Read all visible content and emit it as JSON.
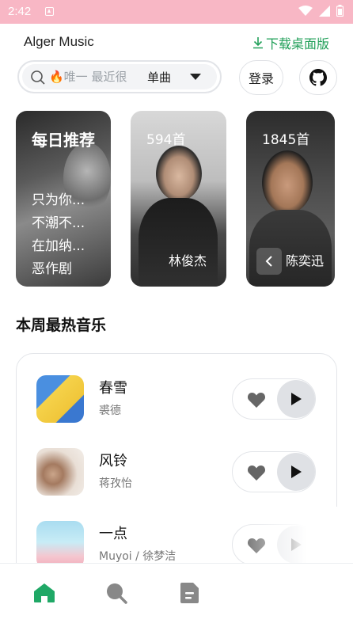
{
  "statusbar": {
    "time": "2:42"
  },
  "header": {
    "app_title": "Alger Music",
    "download_label": "下载桌面版"
  },
  "search": {
    "placeholder": "🔥唯一 最近很",
    "type_selected": "单曲"
  },
  "login_label": "登录",
  "carousel": {
    "daily": {
      "title": "每日推荐",
      "songs": [
        "只为你...",
        "不潮不...",
        "在加纳...",
        "恶作剧"
      ]
    },
    "cards": [
      {
        "count": "594首",
        "artist": "林俊杰"
      },
      {
        "count": "1845首",
        "artist": "陈奕迅"
      }
    ]
  },
  "section_title": "本周最热音乐",
  "songs": [
    {
      "name": "春雪",
      "artist": "裘德"
    },
    {
      "name": "风铃",
      "artist": "蒋孜怡"
    },
    {
      "name": "一点",
      "artist": "Muyoi / 徐梦洁"
    }
  ],
  "colors": {
    "accent": "#22a05a",
    "statusbar": "#f8b7c5"
  },
  "nav": [
    "home-icon",
    "search-icon",
    "document-icon"
  ]
}
